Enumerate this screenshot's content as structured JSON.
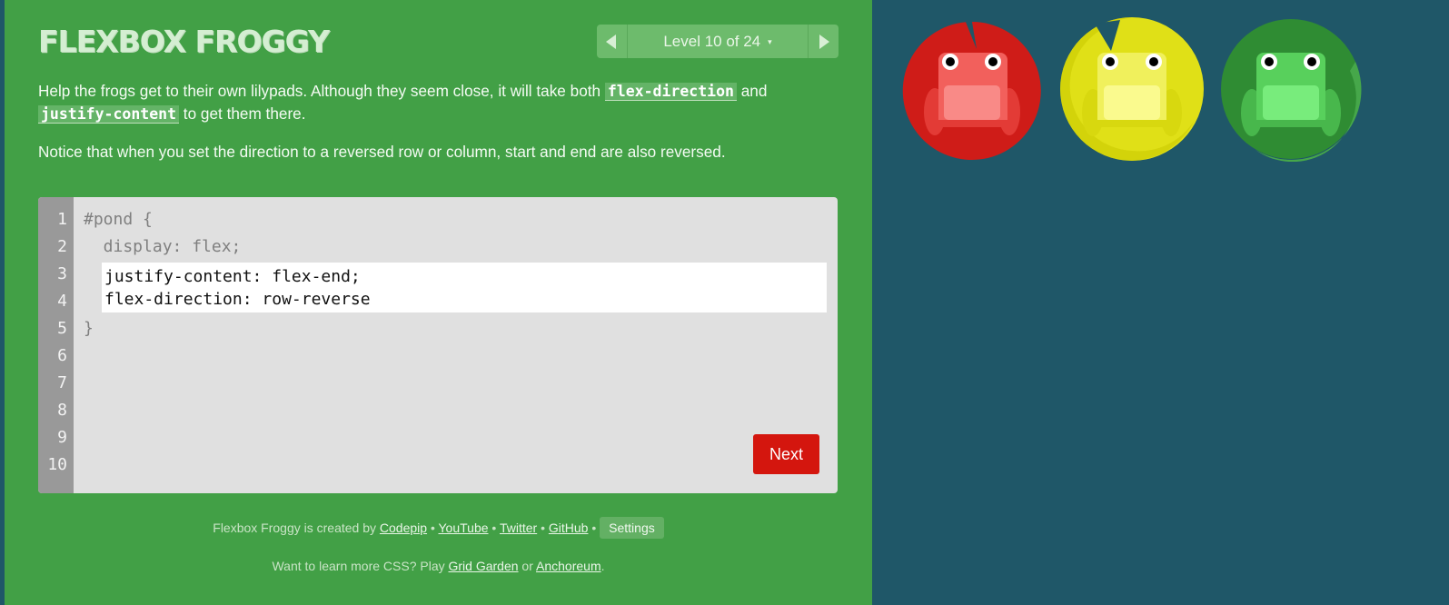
{
  "header": {
    "title": "FLEXBOX FROGGY"
  },
  "level_nav": {
    "label": "Level 10 of 24",
    "caret": "▾"
  },
  "instructions": {
    "p1_a": "Help the frogs get to their own lilypads. Although they seem close, it will take both ",
    "p1_code1": "flex-direction",
    "p1_b": " and ",
    "p1_code2": "justify-content",
    "p1_c": " to get them there.",
    "p2": "Notice that when you set the direction to a reversed row or column, start and end are also reversed."
  },
  "editor": {
    "line_numbers": [
      "1",
      "2",
      "3",
      "4",
      "5",
      "6",
      "7",
      "8",
      "9",
      "10"
    ],
    "line1": "#pond {",
    "line2": "  display: flex;",
    "line5": "}",
    "input_value": "justify-content: flex-end;\nflex-direction: row-reverse",
    "next_label": "Next"
  },
  "footer": {
    "created_by": "Flexbox Froggy is created by ",
    "links": [
      "Codepip",
      "YouTube",
      "Twitter",
      "GitHub"
    ],
    "separator": " • ",
    "settings_label": "Settings",
    "learn_more": "Want to learn more CSS? Play ",
    "game1": "Grid Garden",
    "or": " or ",
    "game2": "Anchoreum",
    "period": "."
  },
  "pond": {
    "frogs": [
      {
        "color": "red",
        "pad": "#cf1c18",
        "pad_light": "#e8302a",
        "body": "#f2605c",
        "belly": "#f98a87",
        "leg": "#e33b36",
        "notch_dir": "up"
      },
      {
        "color": "yellow",
        "pad": "#e0e017",
        "pad_light": "#c9c900",
        "body": "#f0f05c",
        "belly": "#fafa8e",
        "leg": "#d8d80f",
        "notch_dir": "up-left"
      },
      {
        "color": "green",
        "pad": "#2f8c33",
        "pad_light": "#46a74a",
        "body": "#58d05c",
        "belly": "#78ec7c",
        "leg": "#48b74c",
        "notch_dir": "up-right"
      }
    ]
  }
}
